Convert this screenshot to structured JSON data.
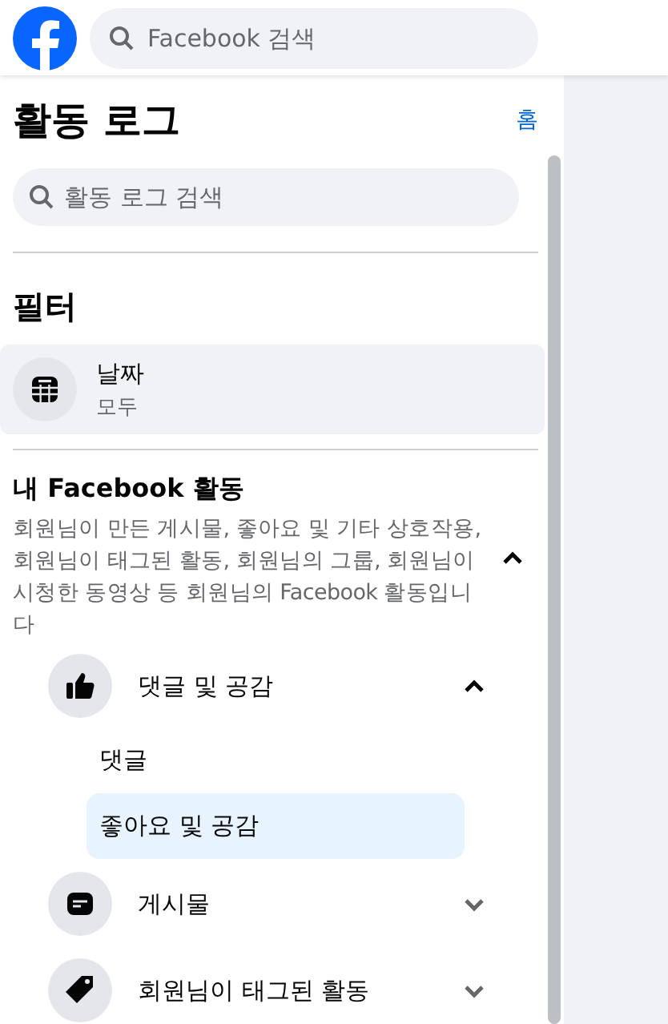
{
  "top_bar": {
    "search": {
      "placeholder": "Facebook 검색"
    }
  },
  "panel": {
    "title": "활동 로그",
    "home_link": "홈",
    "search": {
      "placeholder": "활동 로그 검색"
    }
  },
  "filters": {
    "title": "필터",
    "items": [
      {
        "label": "날짜",
        "value": "모두"
      }
    ]
  },
  "activity": {
    "title": "내 Facebook 활동",
    "description": "회원님이 만든 게시물, 좋아요 및 기타 상호작용, 회원님이 태그된 활동, 회원님의 그룹, 회원님이 시청한 동영상 등 회원님의 Facebook 활동입니다",
    "expanded": true,
    "categories": [
      {
        "label": "댓글 및 공감",
        "expanded": true,
        "children": [
          {
            "label": "댓글",
            "selected": false
          },
          {
            "label": "좋아요 및 공감",
            "selected": true
          }
        ]
      },
      {
        "label": "게시물",
        "expanded": false
      },
      {
        "label": "회원님이 태그된 활동",
        "expanded": false
      }
    ]
  }
}
